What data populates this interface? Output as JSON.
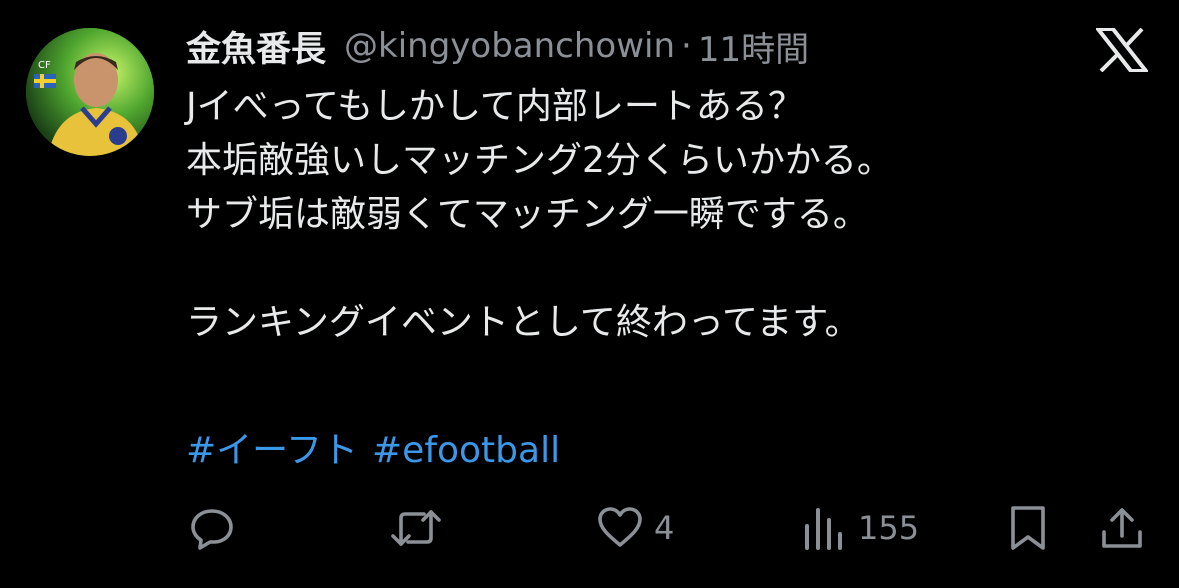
{
  "author": {
    "display_name": "金魚番長",
    "handle": "@kingyobanchowin",
    "separator": "·",
    "time": "11時間",
    "avatar_icon": "player-photo-avatar"
  },
  "brand": {
    "logo_icon": "x-logo-icon"
  },
  "tweet": {
    "lines": [
      "Jイべってもしかして内部レートある？",
      "本垢敵強いしマッチング2分くらいかかる。",
      "サブ垢は敵弱くてマッチング一瞬でする。",
      "",
      "ランキングイベントとして終わってます。"
    ],
    "hashtags": [
      "#イーフト",
      "#efootball"
    ]
  },
  "actions": {
    "reply_icon": "reply-icon",
    "retweet_icon": "retweet-icon",
    "like_icon": "heart-icon",
    "like_count": "4",
    "views_icon": "views-icon",
    "views_count": "155",
    "bookmark_icon": "bookmark-icon",
    "share_icon": "share-icon"
  },
  "colors": {
    "background": "#000000",
    "text": "#e7e9ea",
    "muted": "#8b9097",
    "hashtag": "#3b98e8"
  }
}
